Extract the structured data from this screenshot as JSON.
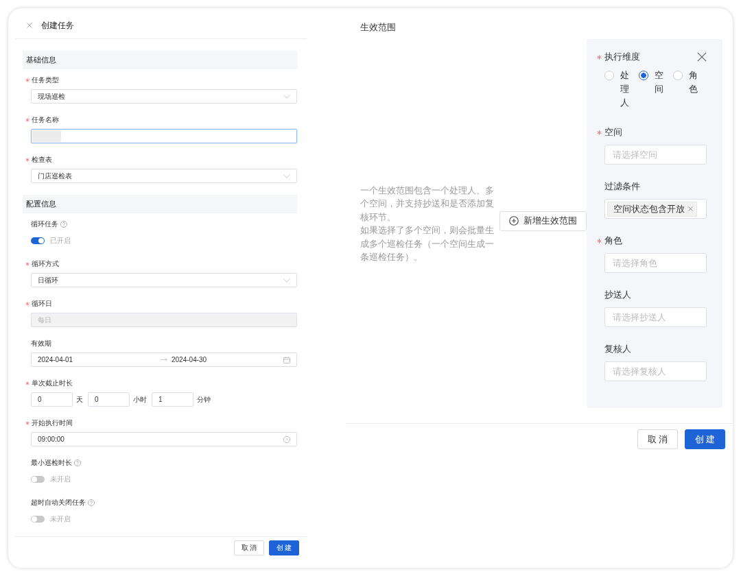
{
  "task_form": {
    "title": "创建任务",
    "sections": [
      {
        "title": "基础信息",
        "fields": [
          {
            "kind": "select",
            "label": "任务类型",
            "required": true,
            "value": "现场巡检"
          },
          {
            "kind": "text",
            "label": "任务名称",
            "required": true,
            "focused": true,
            "disabled": false,
            "redacted": true
          },
          {
            "kind": "select",
            "label": "检查表",
            "required": true,
            "value": "门店巡检表"
          }
        ]
      },
      {
        "title": "配置信息",
        "fields": [
          {
            "kind": "switch",
            "label": "循环任务",
            "help": true,
            "on": true,
            "status": "已开启"
          },
          {
            "kind": "select",
            "label": "循环方式",
            "required": true,
            "value": "日循环"
          },
          {
            "kind": "text",
            "label": "循环日",
            "required": true,
            "focused": false,
            "disabled": true,
            "value": "每日"
          },
          {
            "kind": "date_range",
            "label": "有效期",
            "start": "2024-04-01",
            "end": "2024-04-30"
          },
          {
            "kind": "duration",
            "label": "单次截止时长",
            "required": true,
            "parts": [
              {
                "value": "0",
                "unit": "天"
              },
              {
                "value": "0",
                "unit": "小时"
              },
              {
                "value": "1",
                "unit": "分钟"
              }
            ]
          },
          {
            "kind": "time",
            "label": "开始执行时间",
            "required": true,
            "value": "09:00:00"
          },
          {
            "kind": "switch",
            "label": "最小巡检时长",
            "help": true,
            "on": false,
            "status": "未开启"
          },
          {
            "kind": "switch",
            "label": "超时自动关闭任务",
            "help": true,
            "on": false,
            "status": "未开启"
          }
        ]
      }
    ],
    "buttons": [
      {
        "label": "取 消",
        "kind": "default"
      },
      {
        "label": "创 建",
        "kind": "primary"
      }
    ]
  },
  "scope_panel": {
    "title": "生效范围",
    "description": [
      "一个生效范围包含一个处理人、多个空间，并支持抄送和是否添加复核环节。",
      "如果选择了多个空间，则会批量生成多个巡检任务（一个空间生成一条巡检任务）。"
    ],
    "add_button": "新增生效范围",
    "editor": {
      "dimension": {
        "label": "执行维度",
        "required": true,
        "options": [
          {
            "label": "处理人",
            "selected": false
          },
          {
            "label": "空间",
            "selected": true
          },
          {
            "label": "角色",
            "selected": false
          }
        ]
      },
      "fields": [
        {
          "kind": "input",
          "label": "空间",
          "required": true,
          "placeholder": "请选择空间"
        },
        {
          "kind": "tags",
          "label": "过滤条件",
          "tags": [
            "空间状态包含开放"
          ]
        },
        {
          "kind": "input",
          "label": "角色",
          "required": true,
          "placeholder": "请选择角色"
        },
        {
          "kind": "input",
          "label": "抄送人",
          "placeholder": "请选择抄送人"
        },
        {
          "kind": "input",
          "label": "复核人",
          "placeholder": "请选择复核人"
        }
      ]
    },
    "buttons": [
      {
        "label": "取 消",
        "kind": "default"
      },
      {
        "label": "创 建",
        "kind": "primary"
      }
    ]
  }
}
